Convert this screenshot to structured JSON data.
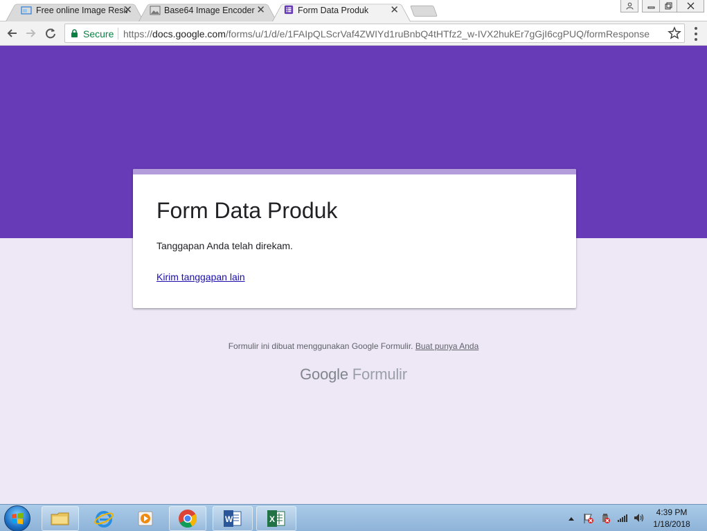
{
  "browser": {
    "tabs": [
      {
        "title": "Free online Image Resize",
        "close": "✕"
      },
      {
        "title": "Base64 Image Encoder",
        "close": "✕"
      },
      {
        "title": "Form Data Produk",
        "close": "✕"
      }
    ],
    "secure_label": "Secure",
    "url_scheme": "https://",
    "url_host": "docs.google.com",
    "url_path": "/forms/u/1/d/e/1FAIpQLScrVaf4ZWIYd1ruBnbQ4tHTfz2_w-IVX2hukEr7gGjI6cgPUQ/formResponse"
  },
  "form": {
    "title": "Form Data Produk",
    "message": "Tanggapan Anda telah direkam.",
    "submit_another": "Kirim tanggapan lain"
  },
  "footer": {
    "note": "Formulir ini dibuat menggunakan Google Formulir.",
    "link": "Buat punya Anda",
    "brand_google": "Google",
    "brand_product": "Formulir"
  },
  "taskbar": {
    "time": "4:39 PM",
    "date": "1/18/2018"
  },
  "colors": {
    "banner": "#673ab7",
    "accent": "#b39ddb",
    "page_bg": "#ede7f6",
    "secure": "#0b8043"
  }
}
